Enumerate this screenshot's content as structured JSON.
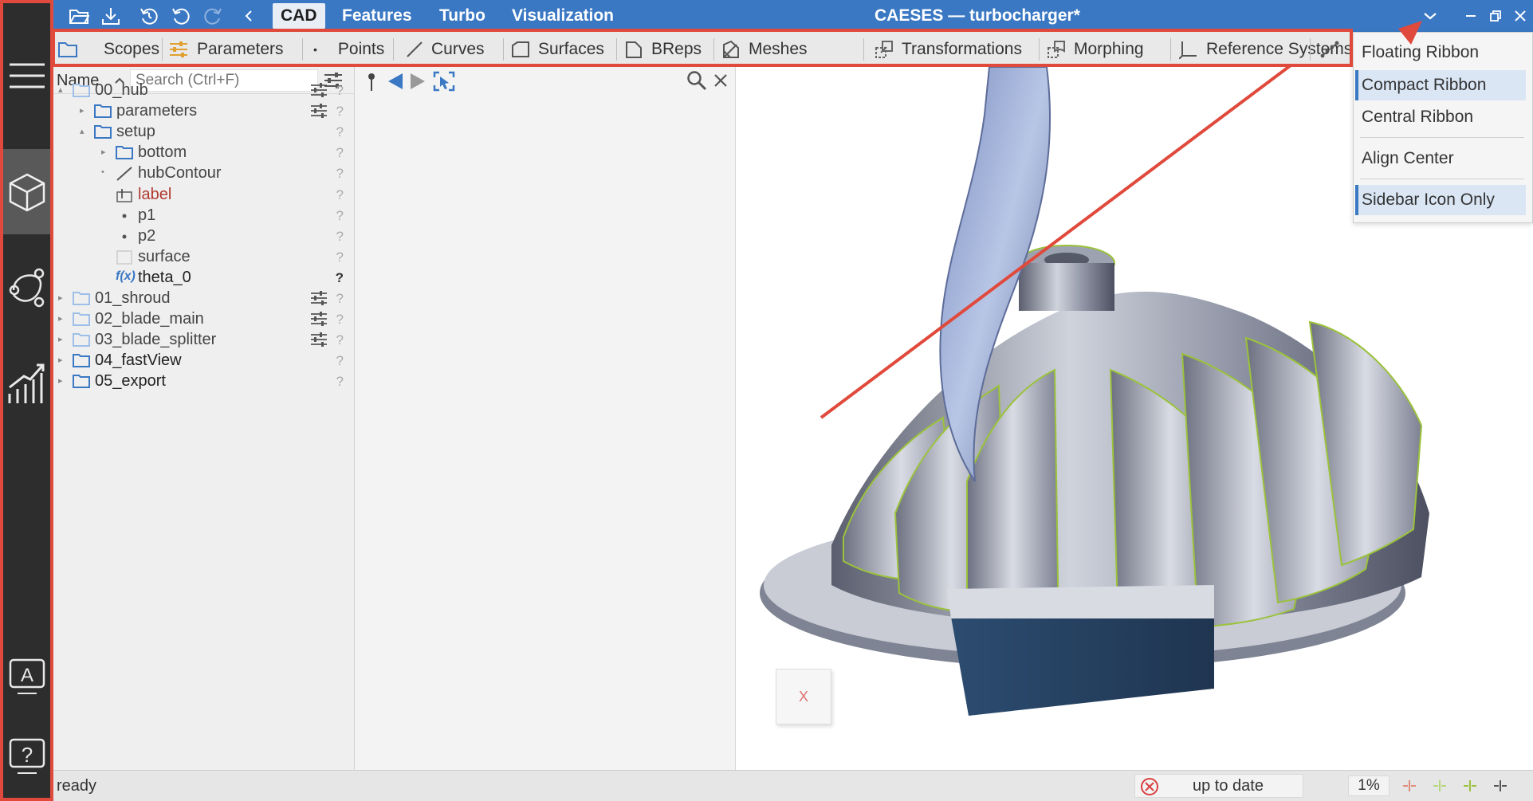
{
  "titlebar": {
    "tabs": [
      "CAD",
      "Features",
      "Turbo",
      "Visualization"
    ],
    "title": "CAESES — turbocharger*"
  },
  "ribbon": {
    "items": [
      "Scopes",
      "Parameters",
      "Points",
      "Curves",
      "Surfaces",
      "BReps",
      "Meshes",
      "Transformations",
      "Morphing",
      "Reference Systems"
    ]
  },
  "tree": {
    "column_label": "Name",
    "search_placeholder": "Search (Ctrl+F)",
    "rows": [
      {
        "label": "00_hub"
      },
      {
        "label": "parameters"
      },
      {
        "label": "setup"
      },
      {
        "label": "bottom"
      },
      {
        "label": "hubContour"
      },
      {
        "label": "label"
      },
      {
        "label": "p1"
      },
      {
        "label": "p2"
      },
      {
        "label": "surface"
      },
      {
        "label": "theta_0",
        "prefix": "f(x)"
      },
      {
        "label": "01_shroud"
      },
      {
        "label": "02_blade_main"
      },
      {
        "label": "03_blade_splitter"
      },
      {
        "label": "04_fastView"
      },
      {
        "label": "05_export"
      }
    ],
    "unknown_marker": "?"
  },
  "dropdown": {
    "items": [
      "Floating Ribbon",
      "Compact Ribbon",
      "Central Ribbon",
      "Align Center",
      "Sidebar Icon Only"
    ]
  },
  "viewport": {
    "cube_label": "X"
  },
  "status": {
    "left": "ready",
    "state": "up to date",
    "zoom": "1%"
  },
  "colors": {
    "accent": "#3a78c4",
    "annotation": "#e04a3c",
    "sidebar": "#2d2d2d"
  }
}
